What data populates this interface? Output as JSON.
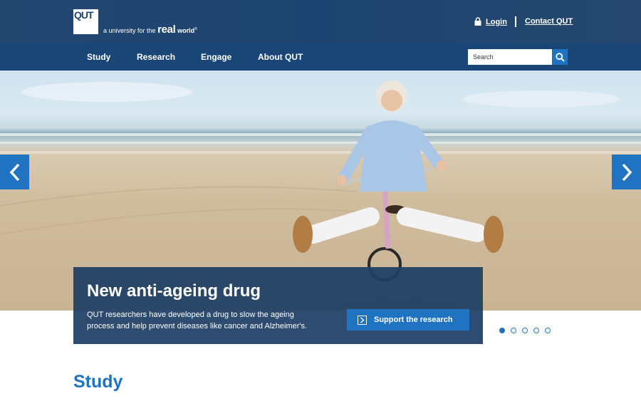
{
  "header": {
    "logo_text": "QUT",
    "tagline_prefix": "a university for the",
    "tagline_real": "real",
    "tagline_world": "world",
    "tagline_mark": "®",
    "login_label": "Login",
    "contact_label": "Contact QUT"
  },
  "nav": {
    "items": [
      {
        "label": "Study"
      },
      {
        "label": "Research"
      },
      {
        "label": "Engage"
      },
      {
        "label": "About QUT"
      }
    ],
    "search_placeholder": "Search"
  },
  "hero": {
    "title": "New anti-ageing drug",
    "text": "QUT researchers have developed a drug to slow the ageing process and help prevent diseases like cancer and Alzheimer's.",
    "cta_label": "Support the research",
    "slide_count": 5,
    "active_slide": 1
  },
  "main": {
    "section_title": "Study"
  },
  "icons": {
    "lock": "lock-icon",
    "search": "search-icon",
    "prev": "chevron-left-icon",
    "next": "chevron-right-icon",
    "cta": "chevron-box-icon"
  },
  "colors": {
    "header_bg": "#1d4470",
    "nav_bg": "#1a4677",
    "accent": "#1f73c0"
  }
}
